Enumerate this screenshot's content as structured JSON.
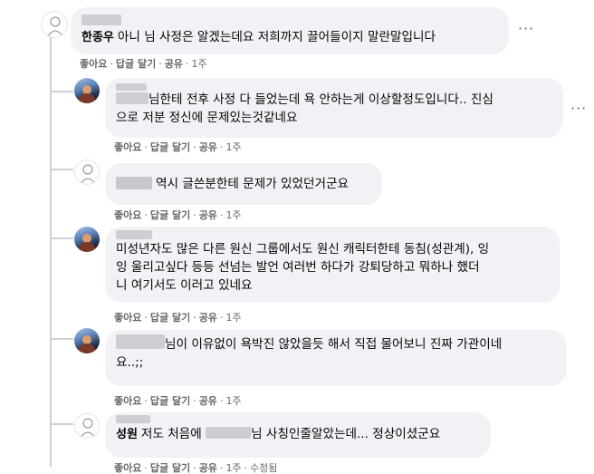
{
  "comments": [
    {
      "author": "한종우",
      "text": "아니 님 사정은 알겠는데요 저희까지 끌어들이지 말란말입니다",
      "actions": {
        "like": "좋아요",
        "reply": "답글 달기",
        "share": "공유",
        "time": "1주"
      }
    },
    {
      "author": "",
      "text_line1": "님한테 전후 사정 다 들었는데 욕 안하는게 이상할정도입니다.. 진심",
      "text_line2": "으로 저분 정신에 문제있는것같네요",
      "actions": {
        "like": "좋아요",
        "reply": "답글 달기",
        "share": "공유",
        "time": "1주"
      }
    },
    {
      "author": "",
      "text": "역시 글쓴분한테 문제가 있었던거군요",
      "actions": {
        "like": "좋아요",
        "reply": "답글 달기",
        "share": "공유",
        "time": "1주"
      }
    },
    {
      "author": "",
      "text_line1": "미성년자도 많은 다른 원신 그룹에서도 원신 캐릭터한테 동침(성관계), 잉",
      "text_line2": "잉 울리고싶다 등등 선넘는 발언 여러번 하다가 강퇴당하고 뭐하나 했더",
      "text_line3": "니 여기서도 이러고 있네요",
      "actions": {
        "like": "좋아요",
        "reply": "답글 달기",
        "share": "공유",
        "time": "1주"
      }
    },
    {
      "author": "",
      "text_line1": "님이 이유없이 욕박진 않았을듯 해서 직접 물어보니 진짜 가관이네",
      "text_line2": "요..;;",
      "actions": {
        "like": "좋아요",
        "reply": "답글 달기",
        "share": "공유",
        "time": "1주"
      }
    },
    {
      "author": "성원",
      "text_before": "저도 처음에",
      "text_after": "님 사칭인줄알았는데... 정상이셨군요",
      "actions": {
        "like": "좋아요",
        "reply": "답글 달기",
        "share": "공유",
        "time": "1주",
        "edited": "수정됨"
      }
    }
  ],
  "more_label": "···",
  "sep": "·"
}
